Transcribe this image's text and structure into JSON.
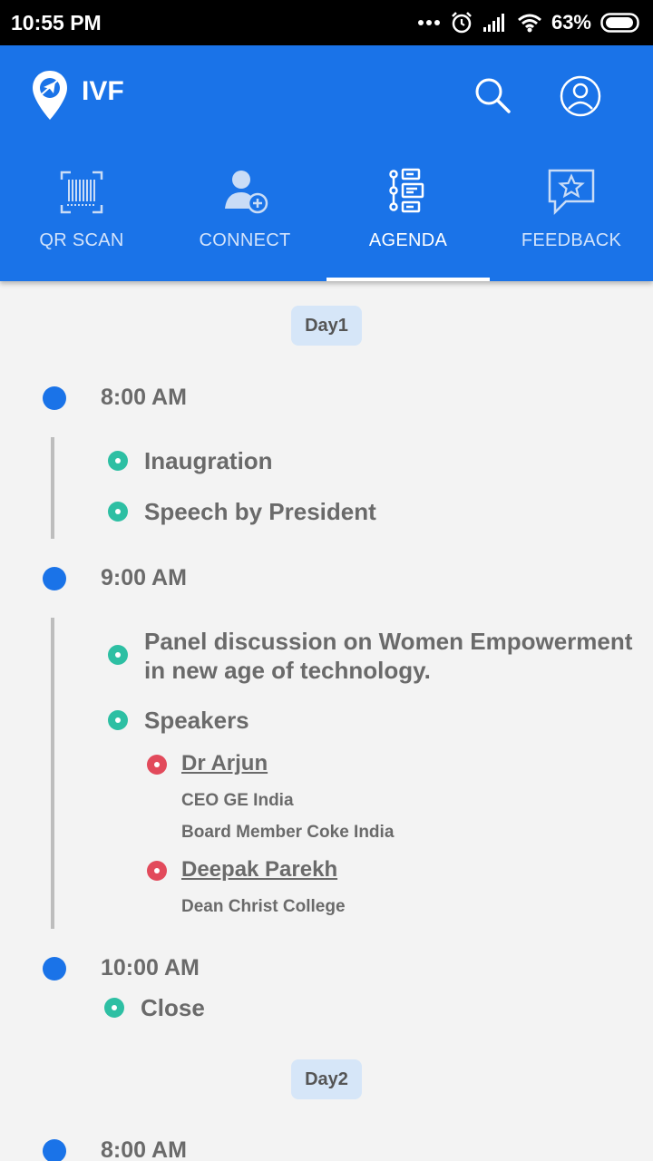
{
  "status_bar": {
    "time": "10:55 PM",
    "battery": "63%",
    "icons": [
      "more-dots-icon",
      "alarm-icon",
      "signal-icon",
      "wifi-icon",
      "battery-icon"
    ]
  },
  "app_bar": {
    "title": "IVF",
    "color": "#1a73e8",
    "actions": [
      "search-icon",
      "profile-icon"
    ]
  },
  "tabs": [
    {
      "label": "QR SCAN",
      "icon": "barcode-icon",
      "active": false
    },
    {
      "label": "CONNECT",
      "icon": "add-user-icon",
      "active": false
    },
    {
      "label": "AGENDA",
      "icon": "agenda-tree-icon",
      "active": true
    },
    {
      "label": "FEEDBACK",
      "icon": "star-feedback-icon",
      "active": false
    }
  ],
  "agenda": {
    "day1": {
      "label": "Day1",
      "slots": [
        {
          "time": "8:00 AM",
          "items": [
            "Inaugration",
            "Speech by President"
          ]
        },
        {
          "time": "9:00 AM",
          "items": [
            "Panel discussion on Women Empowerment",
            "in new age of technology.",
            "Speakers"
          ],
          "speakers": [
            {
              "name": "Dr Arjun",
              "roles": [
                "CEO GE India",
                "Board Member Coke India"
              ]
            },
            {
              "name": "Deepak Parekh",
              "roles": [
                "Dean Christ College"
              ]
            }
          ]
        },
        {
          "time": "10:00 AM",
          "items": [
            "Close"
          ]
        }
      ]
    },
    "day2": {
      "label": "Day2",
      "slots": [
        {
          "time": "8:00 AM"
        }
      ]
    }
  },
  "colors": {
    "time_dot": "#1a73e8",
    "item_dot": "#2dbfa3",
    "speaker_dot": "#e24a5b",
    "badge_bg": "#d6e6f8"
  }
}
